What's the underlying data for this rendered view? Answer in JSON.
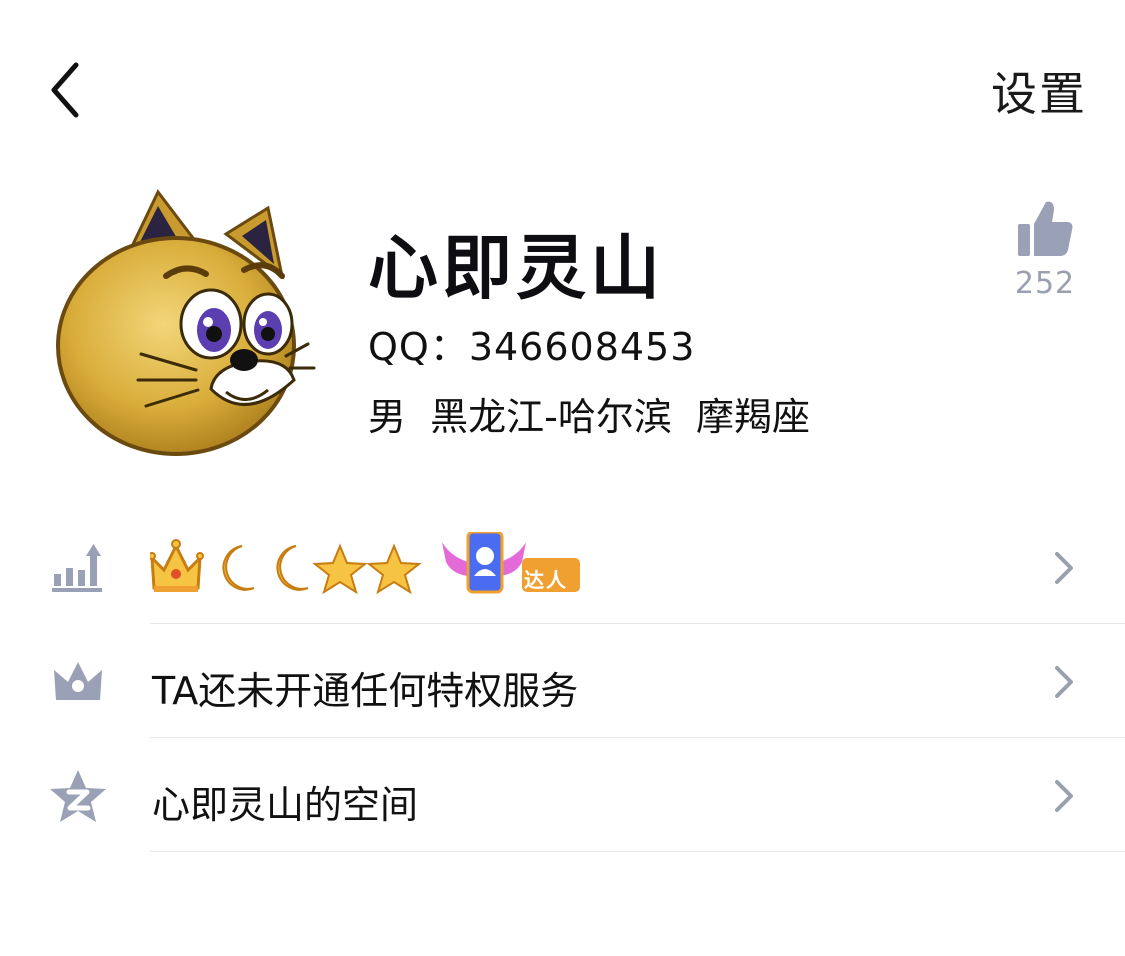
{
  "header": {
    "back_icon": "chevron-left-icon",
    "settings_label": "设置"
  },
  "profile": {
    "avatar_description": "cartoon-cat-avatar",
    "name": "心即灵山",
    "qq_line": "QQ：346608453",
    "info_line": "男  黑龙江-哈尔滨  摩羯座",
    "like_icon": "thumbs-up-icon",
    "like_count": "252"
  },
  "rows": [
    {
      "icon": "level-chart-icon",
      "badges": [
        "crown",
        "moon",
        "moon",
        "star",
        "star"
      ],
      "expert_badge_label": "达人",
      "chevron": "chevron-right-icon"
    },
    {
      "icon": "crown-icon",
      "label": "TA还未开通任何特权服务",
      "chevron": "chevron-right-icon"
    },
    {
      "icon": "qzone-star-icon",
      "label": "心即灵山的空间",
      "chevron": "chevron-right-icon"
    }
  ],
  "colors": {
    "icon_gray": "#9aa0b5",
    "divider": "#e6e6ea",
    "badge_orange": "#f0a030"
  }
}
